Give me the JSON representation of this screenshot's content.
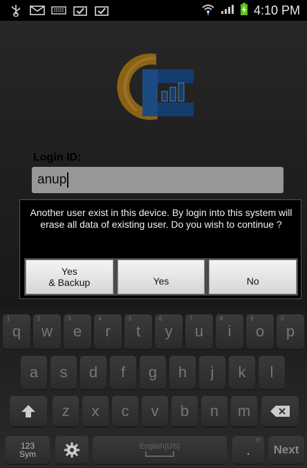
{
  "status_bar": {
    "time": "4:10 PM",
    "left_icons": [
      "usb-icon",
      "mail-icon",
      "keyboard-icon",
      "download-check-icon",
      "download-check-icon"
    ],
    "right_icons": [
      "wifi-icon",
      "signal-icon",
      "battery-charging-icon"
    ]
  },
  "login": {
    "label": "Login ID:",
    "value": "anup"
  },
  "dialog": {
    "message": "Another user exist in this device. By login into this system will erase all data of existing user. Do you wish to continue ?",
    "buttons": {
      "yes_backup_line1": "Yes",
      "yes_backup_line2": "& Backup",
      "yes": "Yes",
      "no": "No"
    }
  },
  "keyboard": {
    "row1": [
      {
        "ch": "q",
        "num": "1"
      },
      {
        "ch": "w",
        "num": "2"
      },
      {
        "ch": "e",
        "num": "3"
      },
      {
        "ch": "r",
        "num": "4"
      },
      {
        "ch": "t",
        "num": "5"
      },
      {
        "ch": "y",
        "num": "6"
      },
      {
        "ch": "u",
        "num": "7"
      },
      {
        "ch": "i",
        "num": "8"
      },
      {
        "ch": "o",
        "num": "9"
      },
      {
        "ch": "p",
        "num": "0"
      }
    ],
    "row2": [
      "a",
      "s",
      "d",
      "f",
      "g",
      "h",
      "j",
      "k",
      "l"
    ],
    "row3": [
      "z",
      "x",
      "c",
      "v",
      "b",
      "n",
      "m"
    ],
    "sym_line1": "123",
    "sym_line2": "Sym",
    "space_label": "English(US)",
    "period_hint": "?!",
    "period": ".",
    "next_label": "Next"
  },
  "colors": {
    "accent_blue": "#1f5fa8",
    "accent_orange": "#e8a21c"
  }
}
